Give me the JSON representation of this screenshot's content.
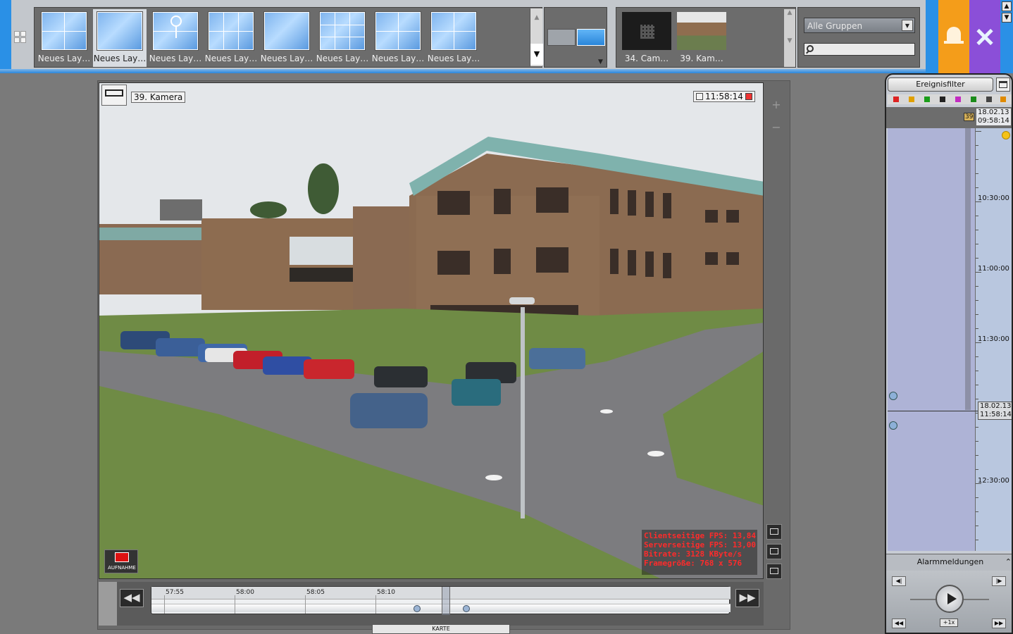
{
  "layouts": [
    {
      "label": "Neues Lay…",
      "kind": "grid4"
    },
    {
      "label": "Neues Lay…",
      "kind": "single",
      "selected": true
    },
    {
      "label": "Neues Lay…",
      "kind": "map"
    },
    {
      "label": "Neues Lay…",
      "kind": "grid6"
    },
    {
      "label": "Neues Lay…",
      "kind": "single"
    },
    {
      "label": "Neues Lay…",
      "kind": "grid9"
    },
    {
      "label": "Neues Lay…",
      "kind": "grid4b"
    },
    {
      "label": "Neues Lay…",
      "kind": "grid4"
    }
  ],
  "cameras": [
    {
      "label": "34. Cam…",
      "thumb": "dark"
    },
    {
      "label": "39. Kam…",
      "thumb": "photo"
    }
  ],
  "group_filter": {
    "selected": "Alle Gruppen",
    "search_placeholder": ""
  },
  "viewer": {
    "camera_title": "39. Kamera",
    "time": "11:58:14",
    "stats": [
      "Clientseitige FPS: 13,84",
      "Serverseitige FPS: 13,00",
      "Bitrate: 3128 KByte/s",
      "Framegröße: 768 x 576"
    ],
    "record_label": "AUFNAHME"
  },
  "timeline": {
    "ticks": [
      "57:55",
      "58:00",
      "58:05",
      "58:10"
    ],
    "tab_label": "KARTE"
  },
  "events": {
    "filter_label": "Ereignisfilter",
    "top_marker": "39",
    "top_date": "18.02.13",
    "top_time": "09:58:14",
    "hours": [
      "10:30:00",
      "11:00:00",
      "11:30:00",
      "12:30:00"
    ],
    "now_date": "18.02.13",
    "now_time": "11:58:14",
    "alarm_label": "Alarmmeldungen",
    "speed_label": "+1x"
  },
  "colors": {
    "accent_blue": "#2a90e6",
    "alarm_orange": "#f49d1a",
    "tools_purple": "#8b4fd8",
    "stats_red": "#ff2b2b"
  }
}
